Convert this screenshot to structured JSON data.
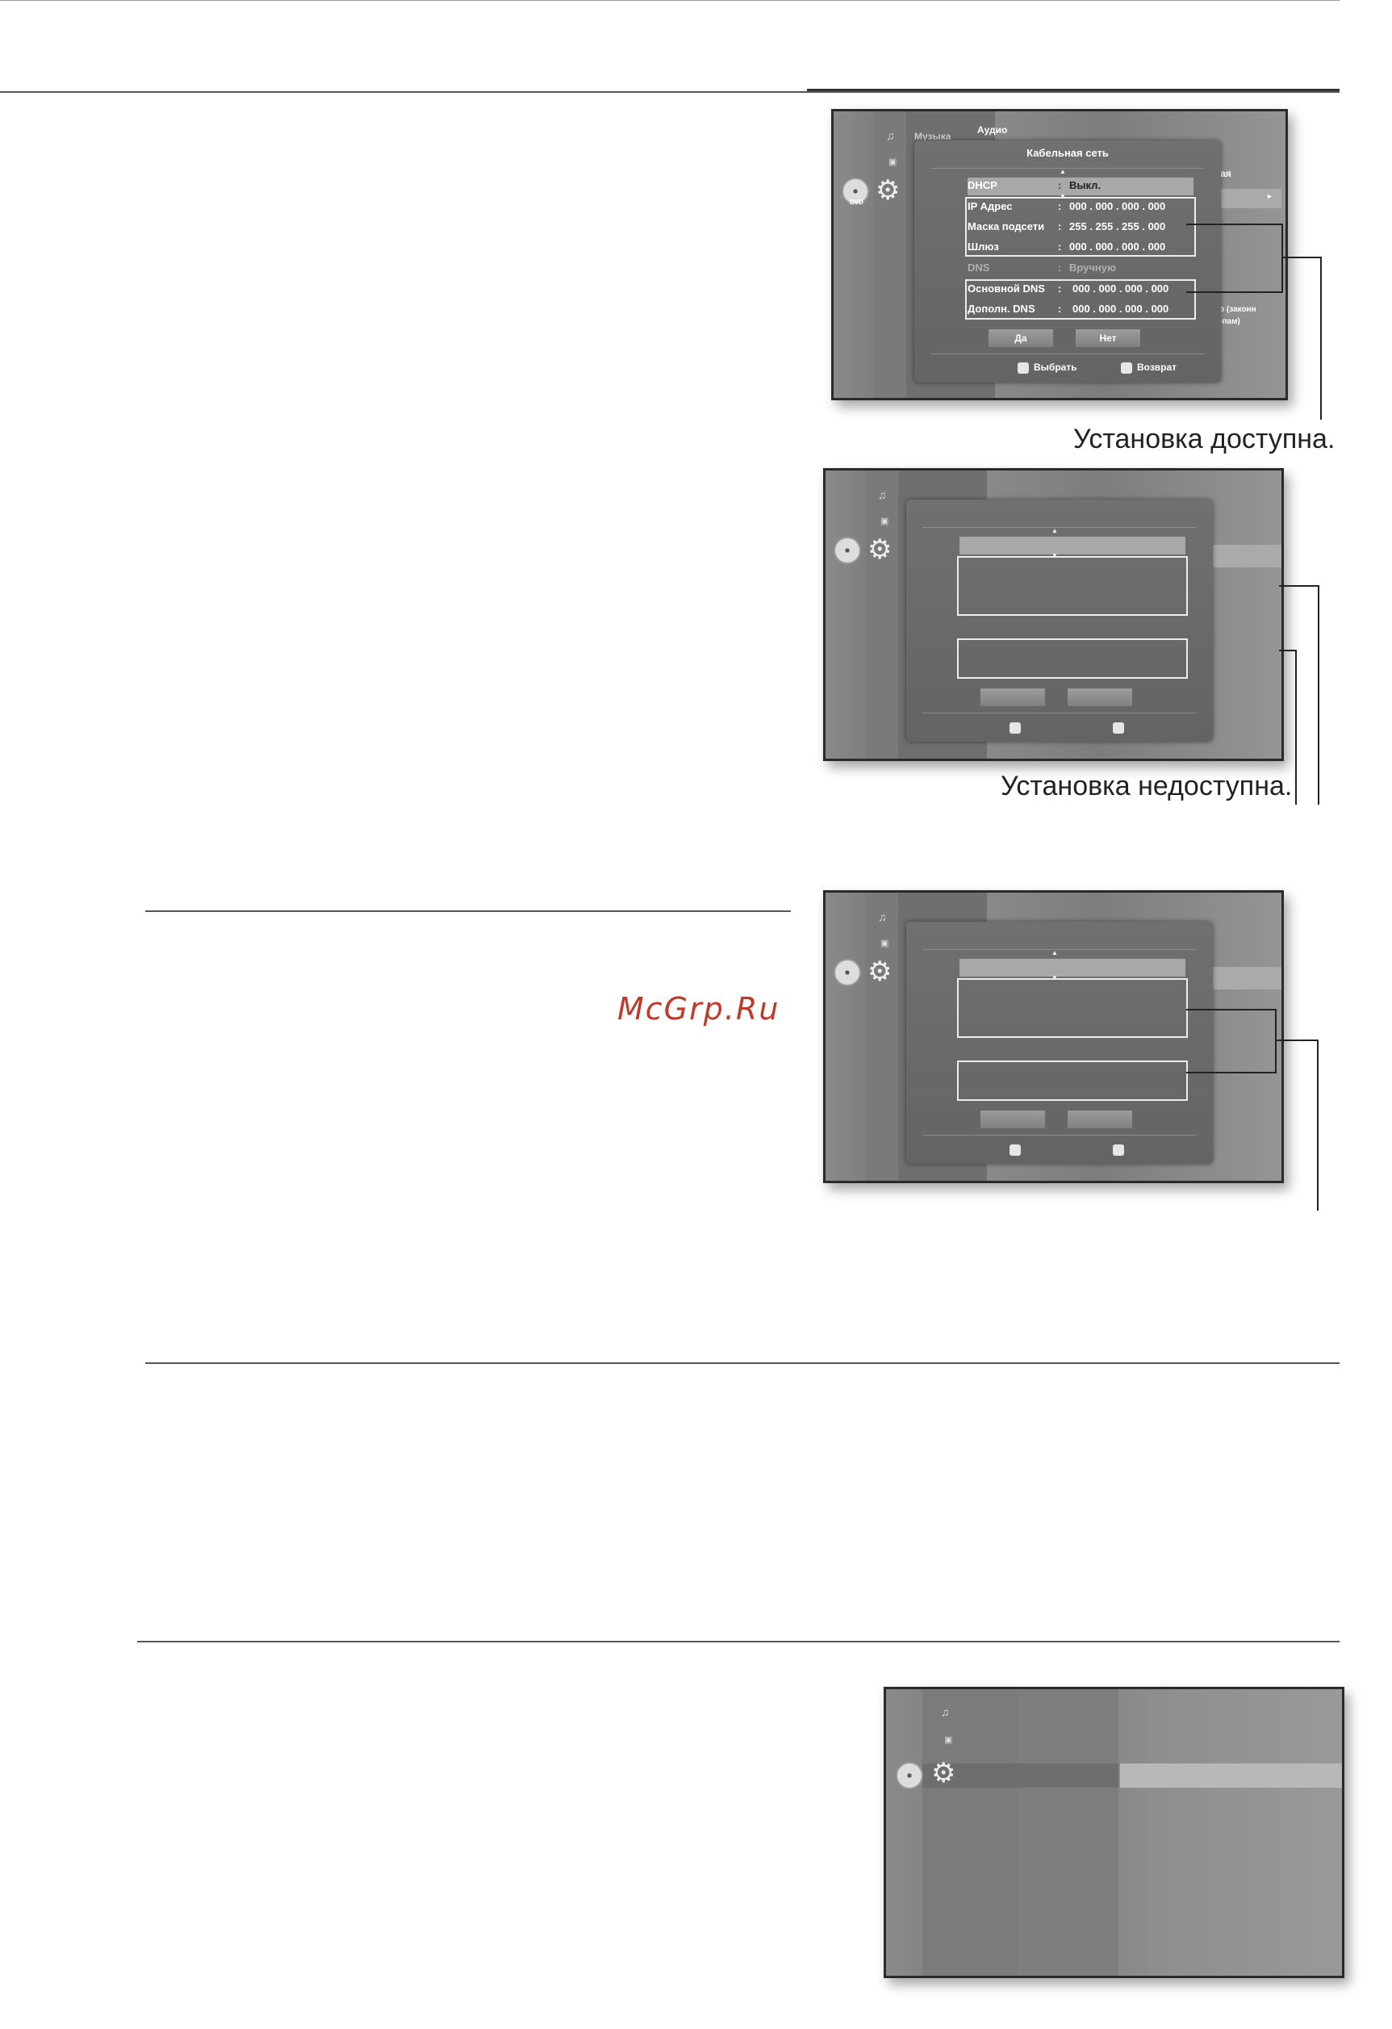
{
  "screen1": {
    "bg_menu_label": "Музыка",
    "bg_audio_label": "Аудио",
    "bg_right_label": "ная",
    "bg_right_arrow": "►",
    "bg_right_note1": "но (законн",
    "bg_right_note2": "и-пам)",
    "dvd_label": "DVD",
    "dialog_title": "Кабельная сеть",
    "scroll_up": "▲",
    "scroll_down": "▼",
    "rows": [
      {
        "label": "DHCP",
        "sep": ":",
        "value": "Выкл."
      },
      {
        "label": "IP Адрес",
        "sep": ":",
        "value": "000 . 000 . 000 . 000"
      },
      {
        "label": "Маска подсети",
        "sep": ":",
        "value": "255 . 255 . 255 . 000"
      },
      {
        "label": "Шлюз",
        "sep": ":",
        "value": "000 . 000 . 000 . 000"
      },
      {
        "label": "DNS",
        "sep": ":",
        "value": "Вручную"
      },
      {
        "label": "Основной DNS",
        "sep": ":",
        "value": "000 . 000 . 000 . 000"
      },
      {
        "label": "Дополн. DNS",
        "sep": ":",
        "value": "000 . 000 . 000 . 000"
      }
    ],
    "yes_button": "Да",
    "no_button": "Нет",
    "select_hint": "Выбрать",
    "return_hint": "Возврат"
  },
  "caption1": "Установка доступна.",
  "caption2": "Установка недоступна.",
  "watermark": "McGrp.Ru",
  "icons": {
    "disc": "disc-icon",
    "gear": "gear-icon",
    "music": "music-icon",
    "photo": "photo-icon",
    "select": "enter-icon",
    "return": "return-icon"
  }
}
